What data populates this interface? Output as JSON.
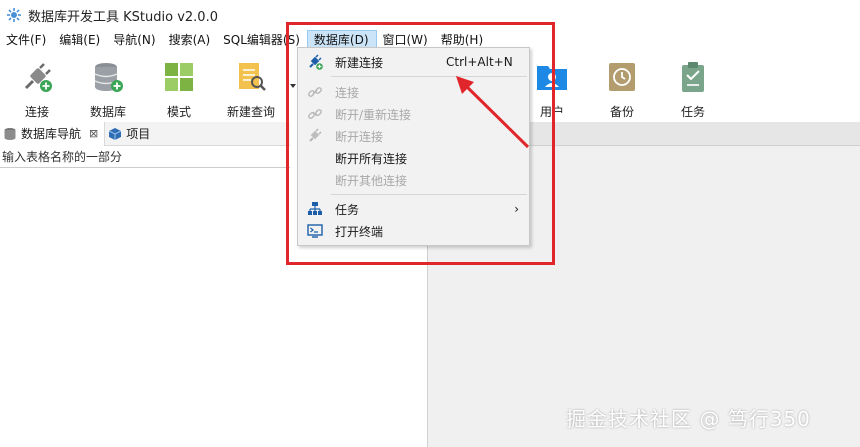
{
  "window": {
    "title": "数据库开发工具 KStudio v2.0.0"
  },
  "menubar": {
    "items": [
      "文件(F)",
      "编辑(E)",
      "导航(N)",
      "搜索(A)",
      "SQL编辑器(S)",
      "数据库(D)",
      "窗口(W)",
      "帮助(H)"
    ]
  },
  "toolbar": {
    "connect": "连接",
    "database": "数据库",
    "schema": "模式",
    "new_query": "新建查询",
    "user": "用户",
    "backup": "备份",
    "task": "任务"
  },
  "tabs": {
    "db_nav": "数据库导航",
    "close_glyph": "⊠",
    "project": "项目"
  },
  "search": {
    "placeholder": "输入表格名称的一部分"
  },
  "dropdown": {
    "new_connection": "新建连接",
    "new_connection_shortcut": "Ctrl+Alt+N",
    "connect": "连接",
    "disconnect_reconnect": "断开/重新连接",
    "disconnect": "断开连接",
    "disconnect_all": "断开所有连接",
    "disconnect_others": "断开其他连接",
    "tasks": "任务",
    "tasks_arrow": "›",
    "open_terminal": "打开终端"
  },
  "watermark": "掘金技术社区 @ 笃行350",
  "colors": {
    "highlight_box": "#e0252b",
    "menu_active_bg": "#cce4f7"
  }
}
